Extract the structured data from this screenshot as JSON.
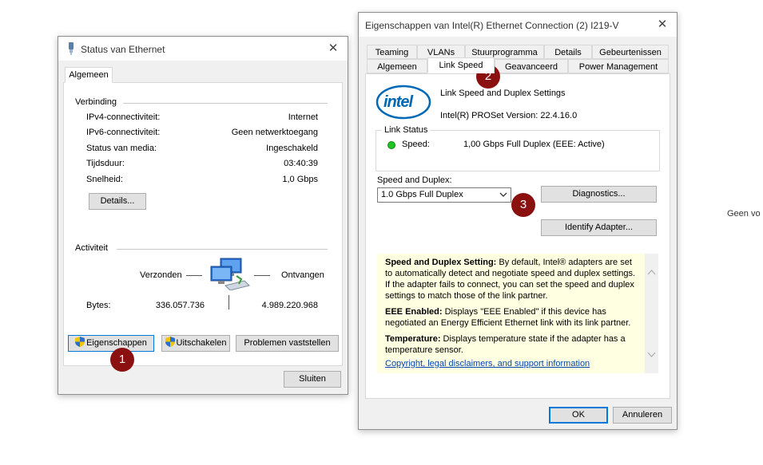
{
  "status_window": {
    "title": "Status van Ethernet",
    "tab": "Algemeen",
    "connection_group": "Verbinding",
    "rows": [
      {
        "label": "IPv4-connectiviteit:",
        "value": "Internet"
      },
      {
        "label": "IPv6-connectiviteit:",
        "value": "Geen netwerktoegang"
      },
      {
        "label": "Status van media:",
        "value": "Ingeschakeld"
      },
      {
        "label": "Tijdsduur:",
        "value": "03:40:39"
      },
      {
        "label": "Snelheid:",
        "value": "1,0 Gbps"
      }
    ],
    "details_button": "Details...",
    "activity_group": "Activiteit",
    "sent_label": "Verzonden",
    "received_label": "Ontvangen",
    "bytes_label": "Bytes:",
    "bytes_sent": "336.057.736",
    "bytes_received": "4.989.220.968",
    "properties_button": "Eigenschappen",
    "disable_button": "Uitschakelen",
    "diagnose_button": "Problemen vaststellen",
    "close_button": "Sluiten"
  },
  "props_window": {
    "title": "Eigenschappen van Intel(R) Ethernet Connection (2) I219-V",
    "tabs_row1": [
      "Teaming",
      "VLANs",
      "Stuurprogramma",
      "Details",
      "Gebeurtenissen"
    ],
    "tabs_row2": [
      "Algemeen",
      "Link Speed",
      "Geavanceerd",
      "Power Management"
    ],
    "active_tab": "Link Speed",
    "logo_text": "intel",
    "heading": "Link Speed and Duplex Settings",
    "version": "Intel(R) PROSet Version: 22.4.16.0",
    "link_status_group": "Link Status",
    "speed_label": "Speed:",
    "speed_value": "1,00 Gbps Full Duplex (EEE: Active)",
    "speed_duplex_label": "Speed and Duplex:",
    "speed_duplex_value": "1.0 Gbps Full Duplex",
    "diagnostics_button": "Diagnostics...",
    "identify_button": "Identify Adapter...",
    "help": [
      {
        "title": "Speed and Duplex Setting:",
        "text": " By default, Intel® adapters are set to automatically detect and negotiate speed and duplex settings. If the adapter fails to connect, you can set the speed and duplex settings to match those of the link partner."
      },
      {
        "title": "EEE Enabled:",
        "text": " Displays \"EEE Enabled\" if this device has negotiated an Energy Efficient Ethernet link with its link partner."
      },
      {
        "title": "Temperature:",
        "text": " Displays temperature state if the adapter has a temperature sensor."
      }
    ],
    "help_link": "Copyright, legal disclaimers, and support information",
    "ok_button": "OK",
    "cancel_button": "Annuleren"
  },
  "badges": [
    "1",
    "2",
    "3"
  ],
  "background_text": "Geen vo",
  "colors": {
    "badge": "#8b1111",
    "status_ok": "#22c322",
    "help_bg": "#ffffe1",
    "focus_blue": "#0078d7",
    "intel_blue": "#0068b5"
  },
  "icons": [
    "ethernet-plug-icon",
    "close-icon",
    "uac-shield-icon",
    "computers-activity-icon",
    "intel-logo",
    "status-dot-icon",
    "chevron-down-icon",
    "scroll-up-icon",
    "scroll-down-icon"
  ]
}
